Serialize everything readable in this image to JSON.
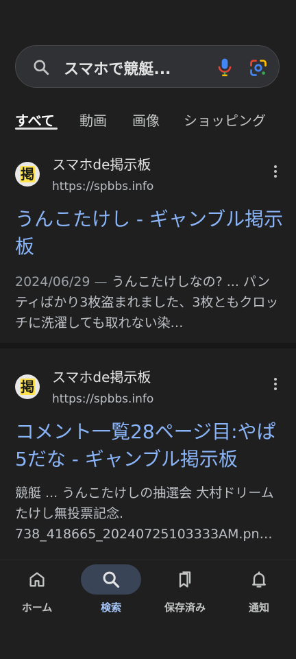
{
  "search": {
    "query": "スマホで競艇..."
  },
  "tabs": [
    {
      "label": "すべて",
      "active": true
    },
    {
      "label": "動画",
      "active": false
    },
    {
      "label": "画像",
      "active": false
    },
    {
      "label": "ショッピング",
      "active": false
    }
  ],
  "results": [
    {
      "favicon_text": "掲",
      "site_name": "スマホde掲示板",
      "url": "https://spbbs.info",
      "title": "うんこたけし - ギャンブル掲示板",
      "date": "2024/06/29 —",
      "snippet": "うんこたけしなの? ... パンティばかり3枚盗まれました、3枚ともクロッチに洗濯しても取れない染…"
    },
    {
      "favicon_text": "掲",
      "site_name": "スマホde掲示板",
      "url": "https://spbbs.info",
      "title": "コメント一覧28ページ目:やぱ5だな - ギャンブル掲示板",
      "snippet": "競艇 ... うんこたけしの抽選会 大村ドリーム たけし無投票記念. 738_418665_20240725103333AM.pn…"
    }
  ],
  "bottom_nav": [
    {
      "label": "ホーム",
      "icon": "home-icon",
      "active": false
    },
    {
      "label": "検索",
      "icon": "search-icon",
      "active": true
    },
    {
      "label": "保存済み",
      "icon": "saved-icon",
      "active": false
    },
    {
      "label": "通知",
      "icon": "bell-icon",
      "active": false
    }
  ],
  "colors": {
    "background": "#1f1f1f",
    "link": "#8ab4f8",
    "active_nav": "#a8c7fa",
    "active_pill": "#394457"
  }
}
